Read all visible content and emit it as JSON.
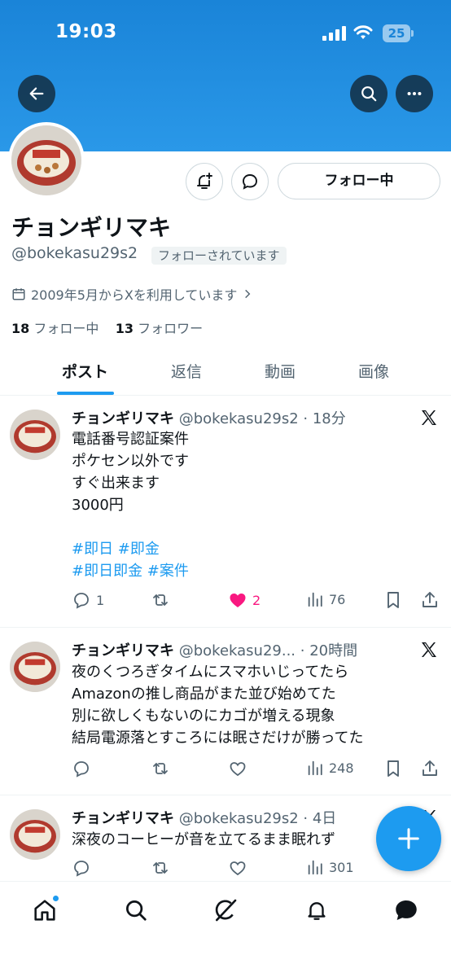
{
  "status_bar": {
    "time": "19:03",
    "battery": "25"
  },
  "profile": {
    "name": "チョンギリマキ",
    "handle": "@bokekasu29s2",
    "follows_you_badge": "フォローされています",
    "joined": "2009年5月からXを利用しています",
    "following_count": "18",
    "following_label": "フォロー中",
    "followers_count": "13",
    "followers_label": "フォロワー",
    "follow_button_label": "フォロー中"
  },
  "tabs": [
    {
      "label": "ポスト",
      "active": true
    },
    {
      "label": "返信",
      "active": false
    },
    {
      "label": "動画",
      "active": false
    },
    {
      "label": "画像",
      "active": false
    }
  ],
  "posts": [
    {
      "name": "チョンギリマキ",
      "meta": "@bokekasu29s2 · 18分",
      "lines": [
        "電話番号認証案件",
        "ポケセン以外です",
        "すぐ出来ます",
        "3000円"
      ],
      "hashtags_line1": "#即日 #即金",
      "hashtags_line2": "#即日即金 #案件",
      "replies": "1",
      "reposts": "",
      "likes": "2",
      "views": "76"
    },
    {
      "name": "チョンギリマキ",
      "meta": "@bokekasu29... · 20時間",
      "lines": [
        "夜のくつろぎタイムにスマホいじってたら",
        "Amazonの推し商品がまた並び始めてた",
        "別に欲しくもないのにカゴが増える現象",
        "結局電源落とすころには眠さだけが勝ってた"
      ],
      "replies": "",
      "reposts": "",
      "likes": "",
      "views": "248"
    },
    {
      "name": "チョンギリマキ",
      "meta": "@bokekasu29s2 · 4日",
      "lines": [
        "深夜のコーヒーが音を立てるまま眠れず"
      ],
      "replies": "",
      "reposts": "",
      "likes": "",
      "views": "301"
    }
  ],
  "colors": {
    "accent": "#1d9bf0",
    "like": "#f91880",
    "banner": "#2a98e8"
  }
}
